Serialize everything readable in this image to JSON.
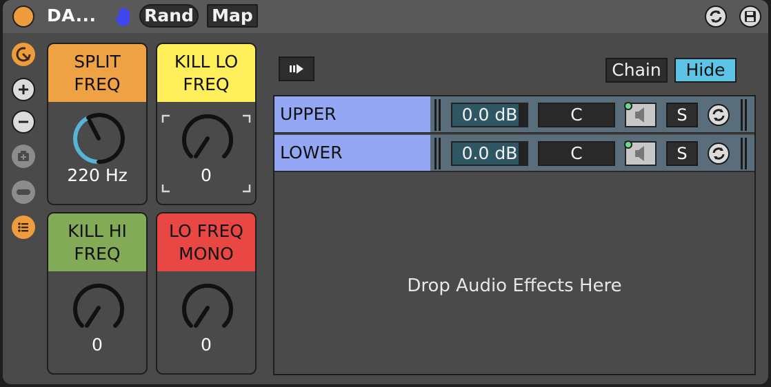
{
  "header": {
    "title": "DA...",
    "rand_label": "Rand",
    "map_label": "Map"
  },
  "macros": [
    {
      "label": "SPLIT\nFREQ",
      "value": "220 Hz",
      "color": "#eea243"
    },
    {
      "label": "KILL LO\nFREQ",
      "value": "0",
      "color": "#ffef5a"
    },
    {
      "label": "KILL HI\nFREQ",
      "value": "0",
      "color": "#83ab57"
    },
    {
      "label": "LO FREQ\nMONO",
      "value": "0",
      "color": "#e84744"
    }
  ],
  "rack": {
    "chain_label": "Chain",
    "hide_label": "Hide",
    "chains": [
      {
        "name": "UPPER",
        "volume": "0.0 dB",
        "pan": "C",
        "solo": "S"
      },
      {
        "name": "LOWER",
        "volume": "0.0 dB",
        "pan": "C",
        "solo": "S"
      }
    ],
    "drop_text": "Drop Audio Effects Here"
  },
  "colors": {
    "accent_orange": "#ee9c3c",
    "chain_blue": "#94a7f4",
    "hide_blue": "#5ec4e6",
    "active_dot": "#6fdc8c"
  }
}
